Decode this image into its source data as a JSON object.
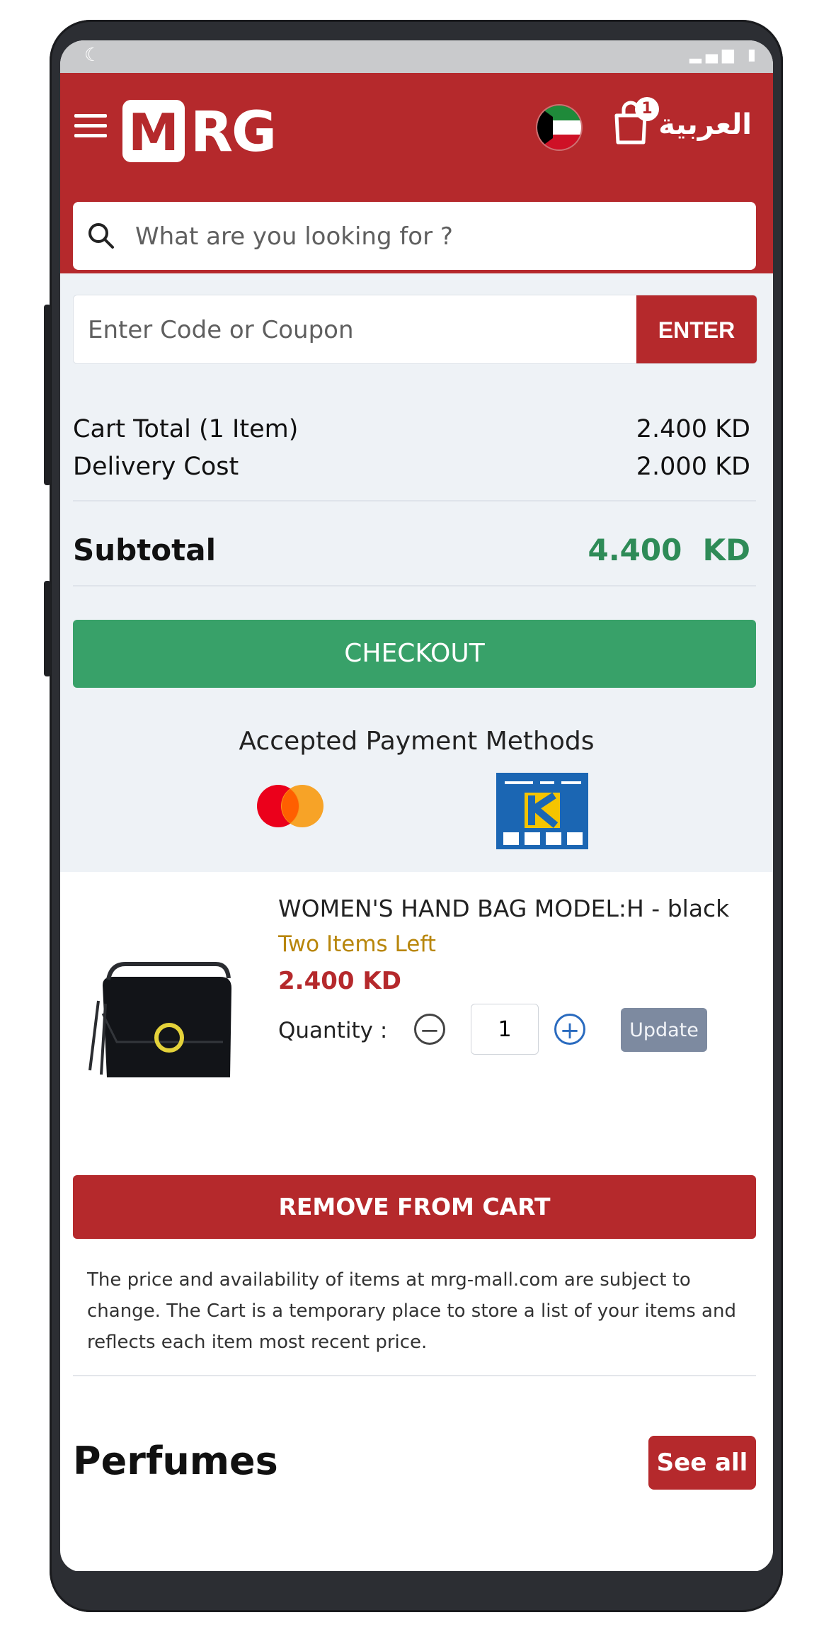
{
  "header": {
    "logo_m": "M",
    "logo_rg": "RG",
    "cart_count": "1",
    "language_label": "العربية",
    "menu_icon": "hamburger-icon",
    "flag_icon": "kuwait-flag-icon",
    "cart_icon": "shopping-bag-icon"
  },
  "search": {
    "placeholder": "What are you looking for ?",
    "icon": "search-icon"
  },
  "coupon": {
    "placeholder": "Enter Code or Coupon",
    "button_label": "ENTER"
  },
  "summary": {
    "cart_total_label": "Cart Total (1 Item)",
    "cart_total_value": "2.400 KD",
    "delivery_label": "Delivery Cost",
    "delivery_value": "2.000 KD",
    "subtotal_label": "Subtotal",
    "subtotal_value": "4.400  KD"
  },
  "checkout_label": "CHECKOUT",
  "payments": {
    "title": "Accepted Payment Methods",
    "methods": [
      "mastercard",
      "knet"
    ]
  },
  "product": {
    "name": "WOMEN'S HAND BAG MODEL:H - black",
    "stock": "Two Items Left",
    "price": "2.400 KD",
    "quantity_label": "Quantity :",
    "quantity_value": "1",
    "update_label": "Update"
  },
  "remove_label": "REMOVE FROM CART",
  "notice": "The price and availability of items at mrg-mall.com are subject to change. The Cart is a temporary place to store a list of your items and reflects each item most recent price.",
  "section": {
    "title": "Perfumes",
    "see_all_label": "See all"
  },
  "colors": {
    "brand_red": "#b5292c",
    "checkout_green": "#38a169",
    "subtotal_green": "#2e8b57",
    "stock_gold": "#b8860b"
  }
}
